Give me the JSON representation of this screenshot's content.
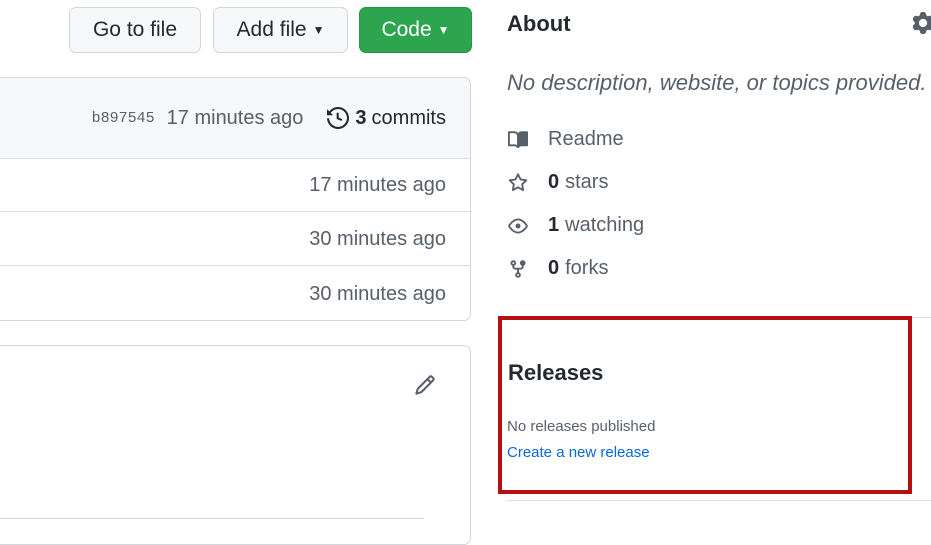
{
  "toolbar": {
    "go_to_file": "Go to file",
    "add_file": "Add file",
    "code": "Code"
  },
  "latest_commit": {
    "sha": "b897545",
    "time": "17 minutes ago",
    "commit_count": "3",
    "commits_label": "commits"
  },
  "files": [
    {
      "updated": "17 minutes ago"
    },
    {
      "updated": "30 minutes ago"
    },
    {
      "updated": "30 minutes ago"
    }
  ],
  "about": {
    "title": "About",
    "description": "No description, website, or topics provided.",
    "readme": "Readme",
    "stars_count": "0",
    "stars_label": "stars",
    "watching_count": "1",
    "watching_label": "watching",
    "forks_count": "0",
    "forks_label": "forks"
  },
  "releases": {
    "title": "Releases",
    "empty_text": "No releases published",
    "create_link": "Create a new release"
  },
  "colors": {
    "primary_button": "#2da44e",
    "link": "#0969da",
    "highlight_box": "#b50f0f"
  },
  "icons": [
    "caret-down-icon",
    "history-icon",
    "pencil-icon",
    "gear-icon",
    "book-icon",
    "star-icon",
    "eye-icon",
    "repo-forked-icon"
  ]
}
